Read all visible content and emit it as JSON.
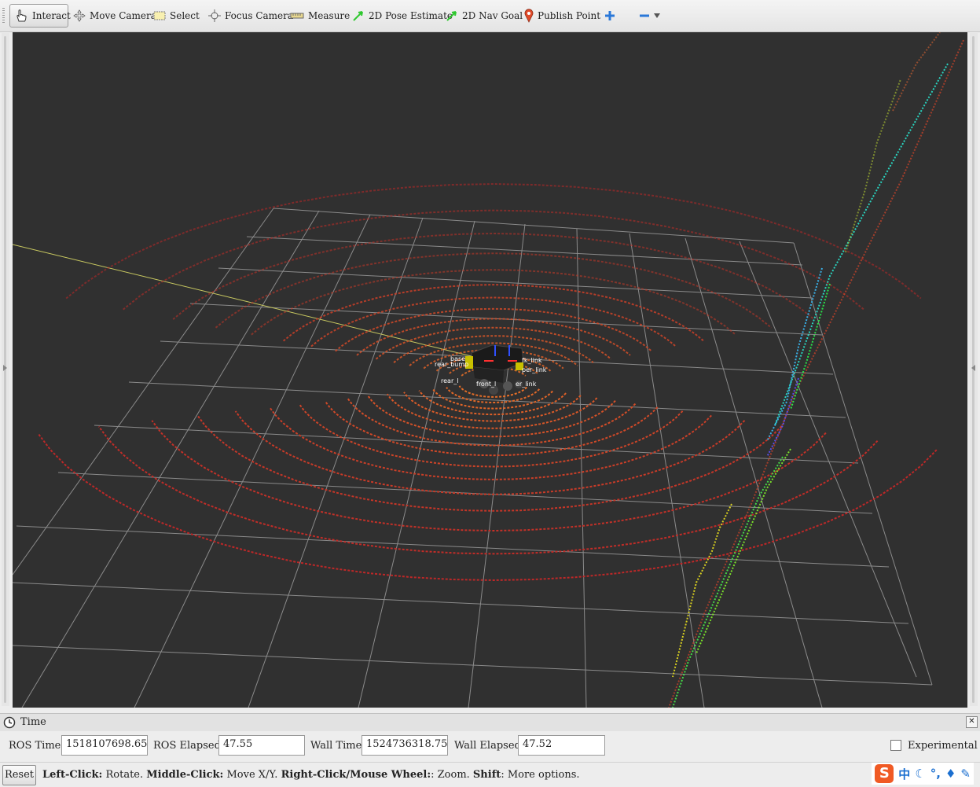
{
  "toolbar": {
    "tools": [
      {
        "label": "Interact",
        "icon": "hand-pointer-icon",
        "active": true
      },
      {
        "label": "Move Camera",
        "icon": "move-arrows-icon"
      },
      {
        "label": "Select",
        "icon": "selection-rectangle-icon"
      },
      {
        "label": "Focus Camera",
        "icon": "crosshair-focus-icon"
      },
      {
        "label": "Measure",
        "icon": "ruler-icon"
      },
      {
        "label": "2D Pose Estimate",
        "icon": "green-arrow-icon"
      },
      {
        "label": "2D Nav Goal",
        "icon": "green-arrow-icon"
      },
      {
        "label": "Publish Point",
        "icon": "map-pin-icon"
      }
    ],
    "add_tool_icon": "plus-icon",
    "remove_tool_icon": "minus-icon"
  },
  "viewport": {
    "background": "#303030",
    "grid_color": "#a0a0a0",
    "robot_link_labels": [
      "base",
      "rear_bump",
      "fk_link",
      "per_link",
      "rear_l",
      "front_l",
      "er_link"
    ]
  },
  "time_panel": {
    "title": "Time",
    "ros_time_label": "ROS Time:",
    "ros_time": "1518107698.65",
    "ros_elapsed_label": "ROS Elapsed:",
    "ros_elapsed": "47.55",
    "wall_time_label": "Wall Time:",
    "wall_time": "1524736318.75",
    "wall_elapsed_label": "Wall Elapsed:",
    "wall_elapsed": "47.52",
    "experimental_label": "Experimental",
    "experimental_checked": false
  },
  "statusbar": {
    "reset_label": "Reset",
    "left_click": "Left-Click:",
    "left_click_desc": " Rotate. ",
    "middle_click": "Middle-Click:",
    "middle_click_desc": " Move X/Y. ",
    "right_click": "Right-Click/Mouse Wheel:",
    "right_click_desc": ": Zoom. ",
    "shift": "Shift",
    "shift_desc": ": More options.",
    "ime_label": "中"
  }
}
